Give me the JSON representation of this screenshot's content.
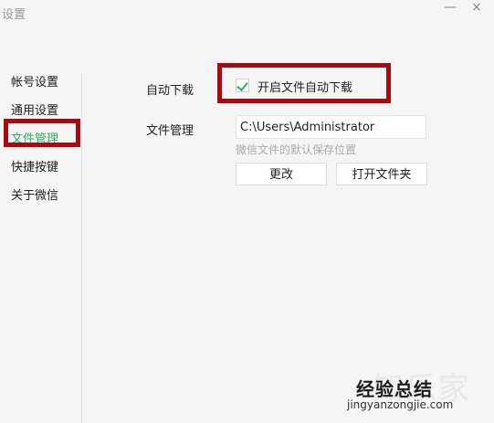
{
  "window": {
    "title": "设置",
    "minimize_glyph": "—",
    "close_glyph": "×"
  },
  "sidebar": {
    "items": [
      {
        "label": "帐号设置",
        "active": false
      },
      {
        "label": "通用设置",
        "active": false
      },
      {
        "label": "文件管理",
        "active": true
      },
      {
        "label": "快捷按键",
        "active": false
      },
      {
        "label": "关于微信",
        "active": false
      }
    ]
  },
  "settings": {
    "auto_download": {
      "label": "自动下载",
      "checkbox_label": "开启文件自动下载",
      "checked": true
    },
    "file_management": {
      "label": "文件管理",
      "path_value": "C:\\Users\\Administrator",
      "hint": "微信文件的默认保存位置",
      "change_button": "更改",
      "open_folder_button": "打开文件夹"
    }
  },
  "watermark": {
    "main_text": "经验总结",
    "ghost_text": "知乐家",
    "url": "jingyanzongjie.com"
  },
  "colors": {
    "accent_green": "#2aae67",
    "highlight_red": "#a50c12",
    "background": "#f5f5f5"
  }
}
